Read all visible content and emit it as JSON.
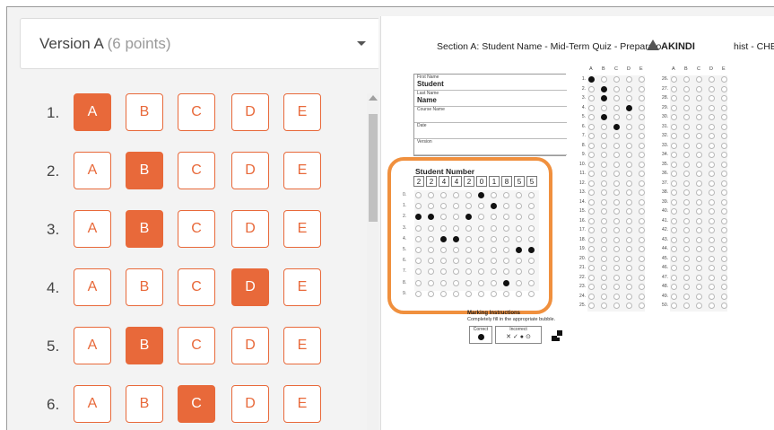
{
  "version_select": {
    "label": "Version A",
    "points": "(6 points)"
  },
  "questions": [
    {
      "number": "1.",
      "options": [
        "A",
        "B",
        "C",
        "D",
        "E"
      ],
      "selected": 0
    },
    {
      "number": "2.",
      "options": [
        "A",
        "B",
        "C",
        "D",
        "E"
      ],
      "selected": 1
    },
    {
      "number": "3.",
      "options": [
        "A",
        "B",
        "C",
        "D",
        "E"
      ],
      "selected": 1
    },
    {
      "number": "4.",
      "options": [
        "A",
        "B",
        "C",
        "D",
        "E"
      ],
      "selected": 3
    },
    {
      "number": "5.",
      "options": [
        "A",
        "B",
        "C",
        "D",
        "E"
      ],
      "selected": 1
    },
    {
      "number": "6.",
      "options": [
        "A",
        "B",
        "C",
        "D",
        "E"
      ],
      "selected": 2
    }
  ],
  "sheet": {
    "title": "Section A: Student Name - Mid-Term Quiz - Preparato",
    "logo": "AKINDI",
    "title_tail": "hist    - CHEM",
    "info_fields": [
      {
        "label": "First Name",
        "value": "Student"
      },
      {
        "label": "Last Name",
        "value": "Name"
      },
      {
        "label": "Course Name",
        "value": ""
      },
      {
        "label": "Date",
        "value": ""
      },
      {
        "label": "Version",
        "value": ""
      }
    ],
    "student_number_title": "Student Number",
    "student_number_digits": [
      "2",
      "2",
      "4",
      "4",
      "2",
      "0",
      "1",
      "8",
      "5",
      "5"
    ],
    "row_labels": [
      "0.",
      "1.",
      "2.",
      "3.",
      "4.",
      "5.",
      "6.",
      "7.",
      "8.",
      "9."
    ],
    "marking_title": "Marking Instructions",
    "marking_sub": "Completely fill in the appropriate bubble.",
    "correct_label": "Correct",
    "incorrect_label": "Incorrect",
    "incorrect_marks": "✕ ✓ ● ⊙",
    "answer_columns": [
      "A",
      "B",
      "C",
      "D",
      "E"
    ],
    "answers_left": [
      0,
      1,
      1,
      3,
      1,
      2,
      -1,
      -1,
      -1,
      -1,
      -1,
      -1,
      -1,
      -1,
      -1,
      -1,
      -1,
      -1,
      -1,
      -1,
      -1,
      -1,
      -1,
      -1,
      -1
    ],
    "answers_right": [
      -1,
      -1,
      -1,
      -1,
      -1,
      -1,
      -1,
      -1,
      -1,
      -1,
      -1,
      -1,
      -1,
      -1,
      -1,
      -1,
      -1,
      -1,
      -1,
      -1,
      -1,
      -1,
      -1,
      -1,
      -1
    ]
  },
  "colors": {
    "accent": "#e8693a",
    "highlight": "#f0903e"
  }
}
